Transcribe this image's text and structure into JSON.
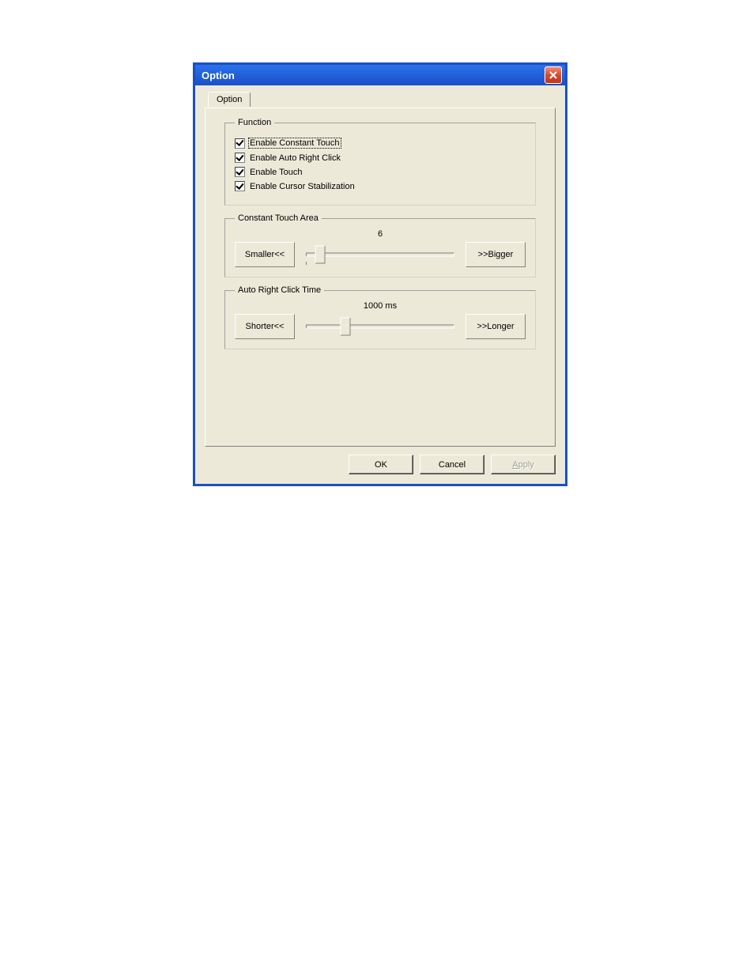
{
  "window": {
    "title": "Option"
  },
  "tab": {
    "label": "Option"
  },
  "functionGroup": {
    "legend": "Function",
    "items": [
      {
        "label": "Enable Constant Touch",
        "checked": true,
        "focused": true
      },
      {
        "label": "Enable Auto Right Click",
        "checked": true,
        "focused": false
      },
      {
        "label": "Enable Touch",
        "checked": true,
        "focused": false
      },
      {
        "label": "Enable Cursor Stabilization",
        "checked": true,
        "focused": false
      }
    ]
  },
  "constantTouchArea": {
    "legend": "Constant Touch Area",
    "value": "6",
    "smallerLabel": "Smaller<<",
    "biggerLabel": ">>Bigger",
    "thumbPercent": 12
  },
  "autoRightClickTime": {
    "legend": "Auto Right Click Time",
    "value": "1000 ms",
    "shorterLabel": "Shorter<<",
    "longerLabel": ">>Longer",
    "thumbPercent": 28
  },
  "buttons": {
    "ok": "OK",
    "cancel": "Cancel",
    "apply": "Apply"
  }
}
